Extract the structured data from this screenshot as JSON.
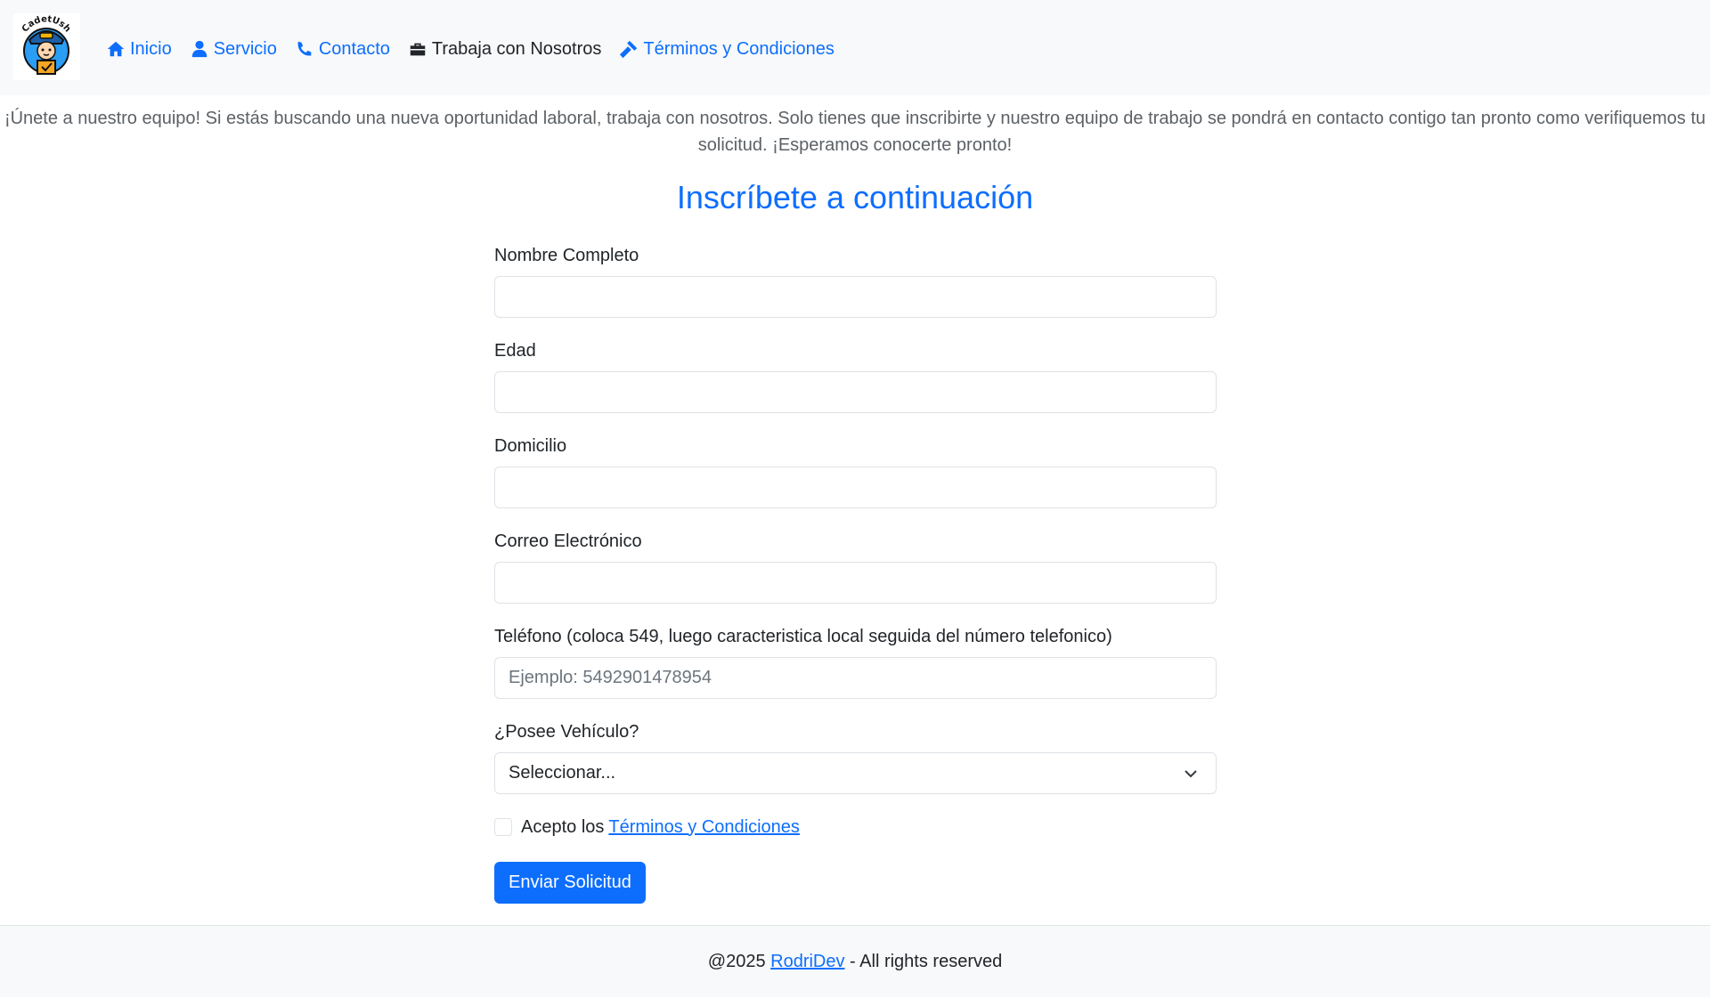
{
  "nav": {
    "logo_text": "CadetUsh",
    "items": [
      {
        "label": "Inicio",
        "icon": "home-icon",
        "active": false
      },
      {
        "label": "Servicio",
        "icon": "user-icon",
        "active": false
      },
      {
        "label": "Contacto",
        "icon": "phone-icon",
        "active": false
      },
      {
        "label": "Trabaja con Nosotros",
        "icon": "toolbox-icon",
        "active": true
      },
      {
        "label": "Términos y Condiciones",
        "icon": "gavel-icon",
        "active": false
      }
    ]
  },
  "intro": "¡Únete a nuestro equipo! Si estás buscando una nueva oportunidad laboral, trabaja con nosotros. Solo tienes que inscribirte y nuestro equipo de trabajo se pondrá en contacto contigo tan pronto como verifiquemos tu solicitud. ¡Esperamos conocerte pronto!",
  "form": {
    "title": "Inscríbete a continuación",
    "fields": {
      "name": {
        "label": "Nombre Completo",
        "value": "",
        "placeholder": ""
      },
      "age": {
        "label": "Edad",
        "value": "",
        "placeholder": ""
      },
      "address": {
        "label": "Domicilio",
        "value": "",
        "placeholder": ""
      },
      "email": {
        "label": "Correo Electrónico",
        "value": "",
        "placeholder": ""
      },
      "phone": {
        "label": "Teléfono (coloca 549, luego caracteristica local seguida del número telefonico)",
        "value": "",
        "placeholder": "Ejemplo: 5492901478954"
      },
      "vehicle": {
        "label": "¿Posee Vehículo?",
        "selected": "Seleccionar..."
      }
    },
    "terms": {
      "prefix": "Acepto los",
      "link": "Términos y Condiciones",
      "checked": false
    },
    "submit": "Enviar Solicitud"
  },
  "footer": {
    "prefix": "@2025",
    "link": "RodriDev",
    "suffix": "- All rights reserved"
  },
  "colors": {
    "accent": "#0d6efd",
    "nav_bg": "#f8f9fa",
    "text": "#212529"
  }
}
